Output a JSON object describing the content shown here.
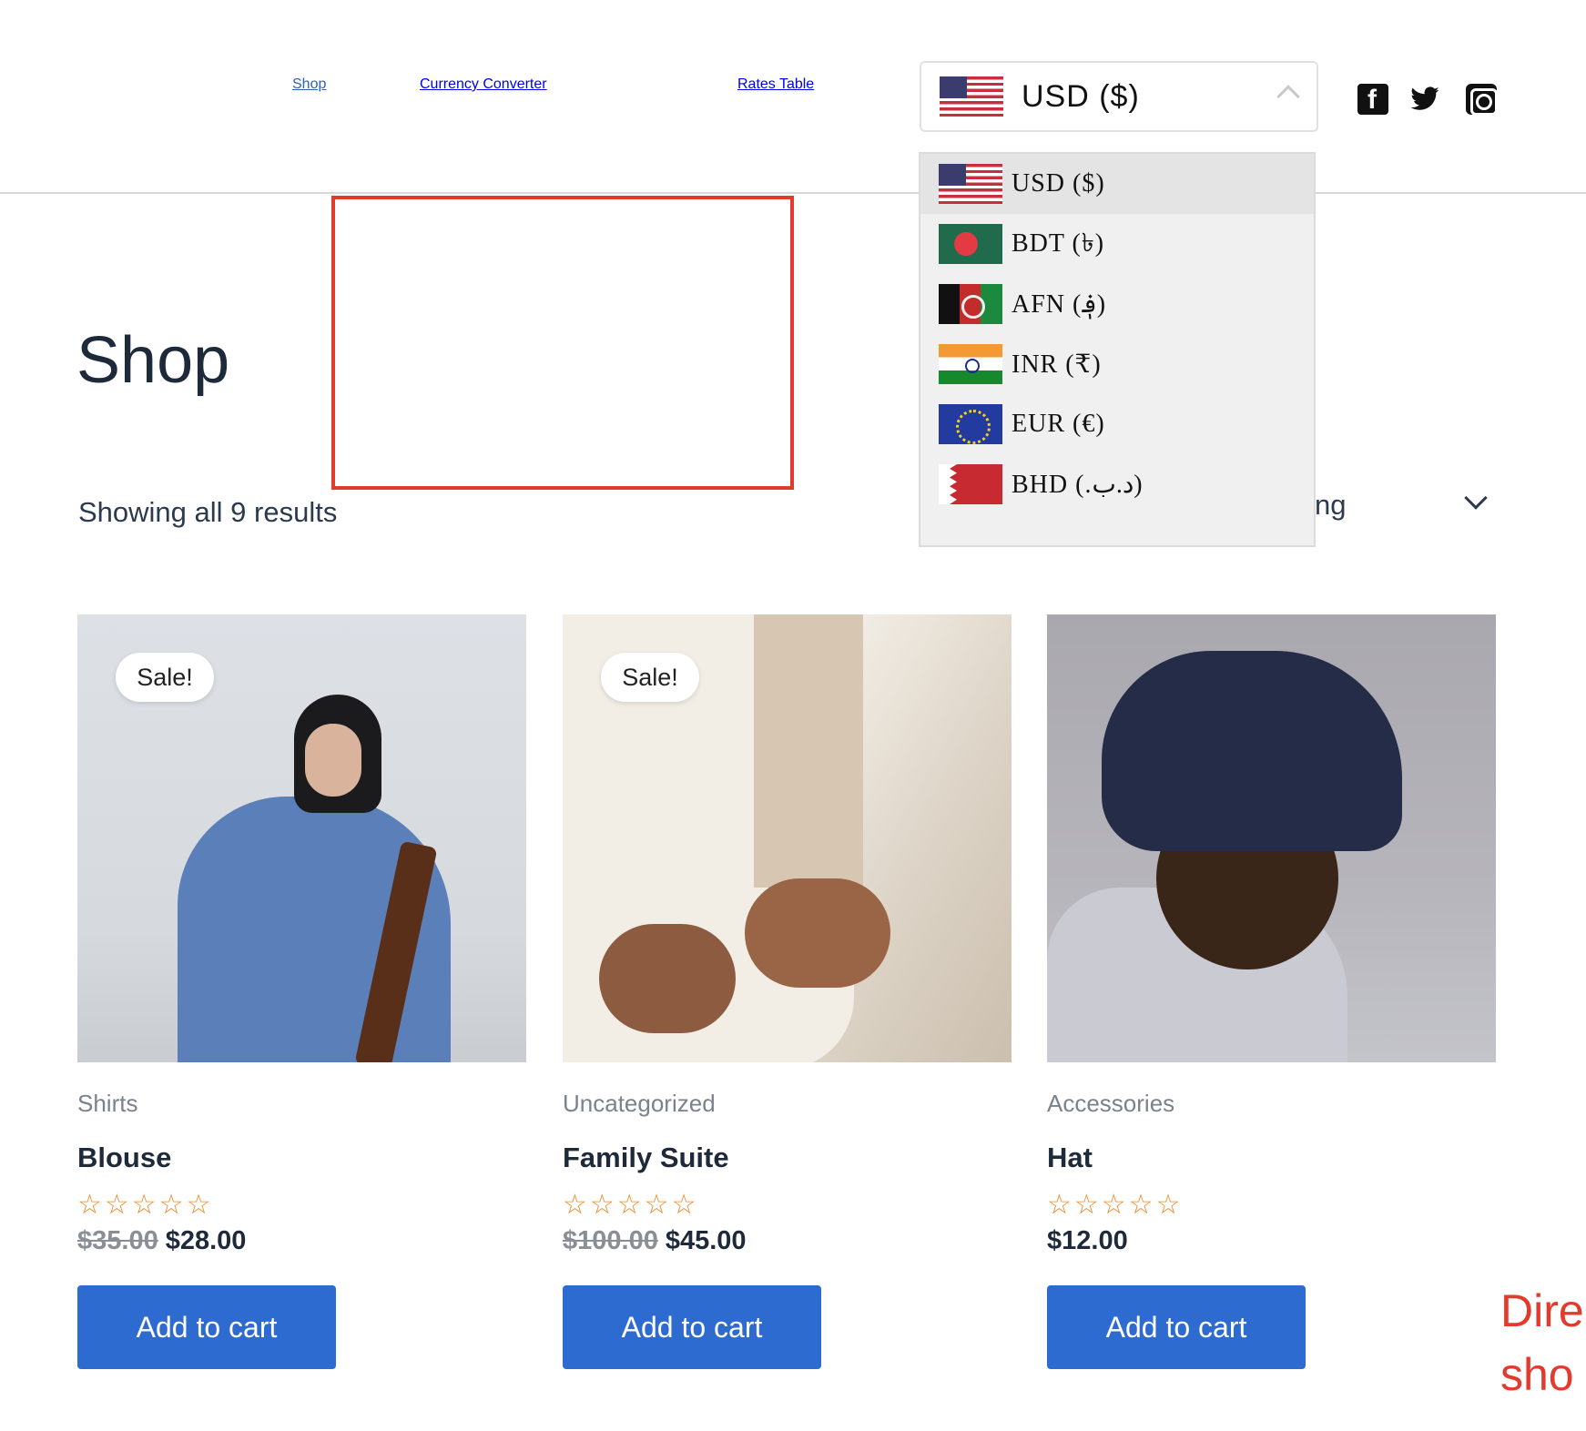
{
  "nav": {
    "shop": "Shop",
    "converter": "Currency Converter",
    "rates": "Rates Table"
  },
  "currency_selector": {
    "selected": "USD  ($)",
    "selected_flag": "us-flag-icon",
    "expanded": true
  },
  "dropdown": {
    "items": [
      {
        "code": "USD",
        "label": "USD ($)",
        "flag": "us-flag-icon",
        "selected": true
      },
      {
        "code": "BDT",
        "label": "BDT (৳)",
        "flag": "bd-flag-icon"
      },
      {
        "code": "AFN",
        "label": "AFN (؋)",
        "flag": "af-flag-icon"
      },
      {
        "code": "INR",
        "label": "INR (₹)",
        "flag": "in-flag-icon"
      },
      {
        "code": "EUR",
        "label": "EUR (€)",
        "flag": "eu-flag-icon"
      },
      {
        "code": "BHD",
        "label": "BHD (.د.ب)",
        "flag": "bh-flag-icon"
      }
    ]
  },
  "social": [
    "facebook-icon",
    "twitter-icon",
    "instagram-icon"
  ],
  "page": {
    "title": "Shop",
    "results": "Showing all 9 results",
    "sort_partial": "ng"
  },
  "products": [
    {
      "badge": "Sale!",
      "category": "Shirts",
      "name": "Blouse",
      "stars": "☆☆☆☆☆",
      "old_price": "$35.00",
      "price": "$28.00",
      "button": "Add to cart"
    },
    {
      "badge": "Sale!",
      "category": "Uncategorized",
      "name": "Family Suite",
      "stars": "☆☆☆☆☆",
      "old_price": "$100.00",
      "price": "$45.00",
      "button": "Add to cart"
    },
    {
      "badge": "",
      "category": "Accessories",
      "name": "Hat",
      "stars": "☆☆☆☆☆",
      "old_price": "",
      "price": "$12.00",
      "button": "Add to cart"
    }
  ],
  "annotation": {
    "line1": "Dire",
    "line2": "sho"
  },
  "colors": {
    "accent": "#2e6bd1",
    "link": "#2e64b3",
    "annotation": "#e23b2e",
    "stars": "#e98b2e"
  }
}
